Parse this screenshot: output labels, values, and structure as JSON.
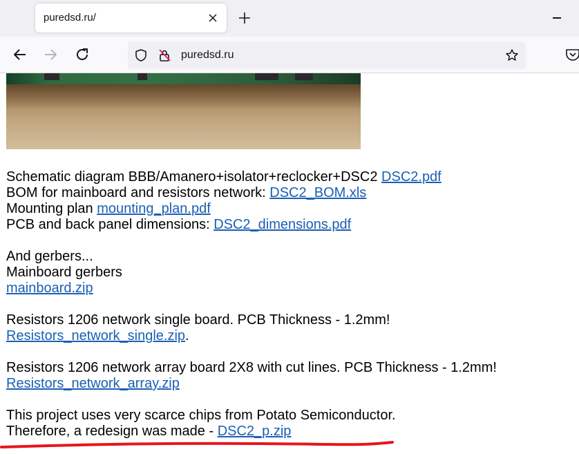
{
  "browser": {
    "tab_title": "puredsd.ru/",
    "url": "puredsd.ru"
  },
  "page": {
    "image_alt": "Assembled DSC2 board photo",
    "lines": {
      "schematic_text": "Schematic diagram BBB/Amanero+isolator+reclocker+DSC2 ",
      "schematic_link": "DSC2.pdf",
      "bom_text": "BOM for mainboard and resistors network: ",
      "bom_link": "DSC2_BOM.xls",
      "mounting_text": "Mounting plan ",
      "mounting_link": "mounting_plan.pdf",
      "pcb_text": "PCB and back panel dimensions: ",
      "pcb_link": "DSC2_dimensions.pdf",
      "gerbers_intro": "And gerbers...",
      "mainboard_gerbers": "Mainboard gerbers",
      "mainboard_link": "mainboard.zip",
      "single_text": "Resistors 1206 network single board. PCB Thickness - 1.2mm!",
      "single_link": "Resistors_network_single.zip",
      "single_suffix": ".",
      "array_text": "Resistors 1206 network array board 2X8 with cut lines. PCB Thickness - 1.2mm!",
      "array_link": "Resistors_network_array.zip",
      "potato_text": "This project uses very scarce chips from Potato Semiconductor.",
      "redesign_text": "Therefore, a redesign was made - ",
      "redesign_link": "DSC2_p.zip"
    }
  },
  "colors": {
    "link": "#1a5fb4",
    "annotation": "#e8141c"
  }
}
